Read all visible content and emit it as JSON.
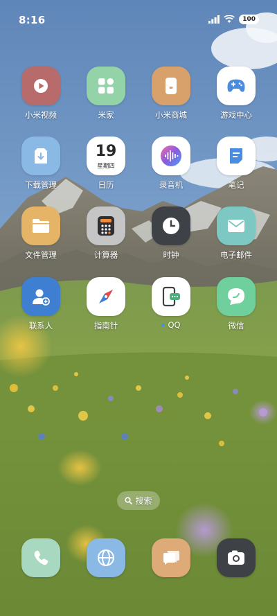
{
  "status_bar": {
    "time": "8:16",
    "battery": "100"
  },
  "apps": {
    "mi_video": "小米视频",
    "mi_home": "米家",
    "mi_store": "小米商城",
    "game_center": "游戏中心",
    "downloads": "下载管理",
    "calendar": "日历",
    "recorder": "录音机",
    "notes": "笔记",
    "file_manager": "文件管理",
    "calculator": "计算器",
    "clock": "时钟",
    "email": "电子邮件",
    "contacts": "联系人",
    "compass": "指南针",
    "qq": "QQ",
    "wechat": "微信"
  },
  "calendar_icon": {
    "day": "19",
    "weekday": "星期四"
  },
  "search": {
    "label": "搜索"
  },
  "colors": {
    "mi_video": "#b86b6b",
    "mi_home": "#94d3a8",
    "mi_store": "#d8a06a",
    "downloads": "#8ab9e6",
    "file_manager": "#e6b466",
    "calculator": "#c5c5c5",
    "clock": "#3e4146",
    "email": "#7dc8c2",
    "contacts": "#3f7fd1",
    "wechat": "#6fcf9d",
    "dock_phone": "#a8d8bf",
    "dock_browser": "#8ab9e6",
    "dock_messages": "#deaa78",
    "dock_camera": "#3e4146"
  }
}
